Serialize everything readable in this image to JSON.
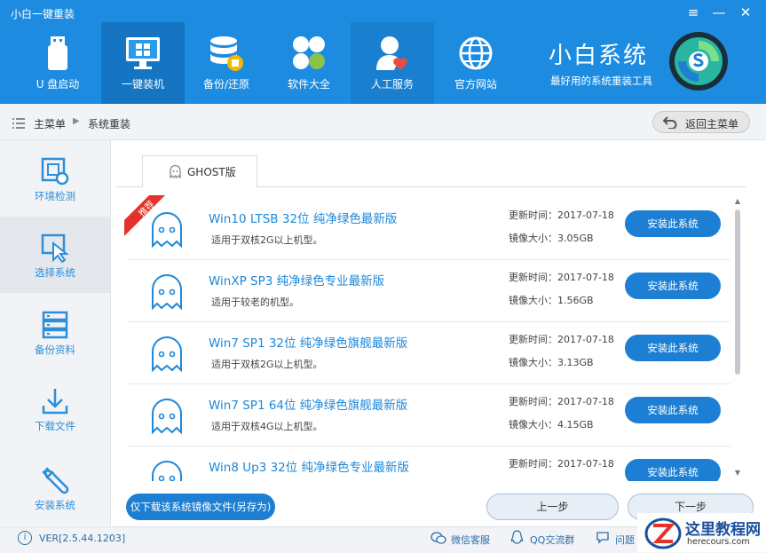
{
  "window": {
    "title": "小白一键重装",
    "menu_icon": "menu-icon",
    "minimize_icon": "minimize-icon",
    "close_icon": "close-icon"
  },
  "nav": [
    {
      "label": "U 盘启动",
      "icon": "usb-icon"
    },
    {
      "label": "一键装机",
      "icon": "monitor-windows-icon",
      "active": true
    },
    {
      "label": "备份/还原",
      "icon": "database-icon"
    },
    {
      "label": "软件大全",
      "icon": "apps-clover-icon"
    },
    {
      "label": "人工服务",
      "icon": "user-heart-icon"
    },
    {
      "label": "官方网站",
      "icon": "globe-icon"
    }
  ],
  "brand": {
    "name": "小白系统",
    "slogan": "最好用的系统重装工具"
  },
  "breadcrumb": {
    "items": [
      "主菜单",
      "系统重装"
    ],
    "back_label": "返回主菜单"
  },
  "sidebar": [
    {
      "label": "环境检测",
      "icon": "hardware-check-icon"
    },
    {
      "label": "选择系统",
      "icon": "cursor-select-icon",
      "active": true
    },
    {
      "label": "备份资料",
      "icon": "server-icon"
    },
    {
      "label": "下载文件",
      "icon": "download-icon"
    },
    {
      "label": "安装系统",
      "icon": "wrench-icon"
    }
  ],
  "tab": {
    "label": "GHOST版"
  },
  "badge": {
    "label": "推荐"
  },
  "systems": [
    {
      "name": "Win10 LTSB 32位 纯净绿色最新版",
      "desc": "适用于双核2G以上机型。",
      "update": "更新时间：2017-07-18",
      "size": "镜像大小：3.05GB",
      "button": "安装此系统"
    },
    {
      "name": "WinXP SP3 纯净绿色专业最新版",
      "desc": "适用于较老的机型。",
      "update": "更新时间：2017-07-18",
      "size": "镜像大小：1.56GB",
      "button": "安装此系统"
    },
    {
      "name": "Win7 SP1 32位 纯净绿色旗舰最新版",
      "desc": "适用于双核2G以上机型。",
      "update": "更新时间：2017-07-18",
      "size": "镜像大小：3.13GB",
      "button": "安装此系统"
    },
    {
      "name": "Win7 SP1 64位 纯净绿色旗舰最新版",
      "desc": "适用于双核4G以上机型。",
      "update": "更新时间：2017-07-18",
      "size": "镜像大小：4.15GB",
      "button": "安装此系统"
    },
    {
      "name": "Win8 Up3 32位 纯净绿色专业最新版",
      "desc": "",
      "update": "更新时间：2017-07-18",
      "size": "",
      "button": "安装此系统"
    }
  ],
  "actions": {
    "download": "仅下载该系统镜像文件(另存为)",
    "prev": "上一步",
    "next": "下一步"
  },
  "footer": {
    "version": "VER[2.5.44.1203]",
    "wechat": "微信客服",
    "qq": "QQ交流群",
    "question": "问题"
  },
  "watermark": {
    "title": "这里教程网",
    "url": "herecours.com"
  },
  "colors": {
    "header": "#1d8ce0",
    "accent": "#1d7fd3",
    "badge": "#e4322b"
  }
}
